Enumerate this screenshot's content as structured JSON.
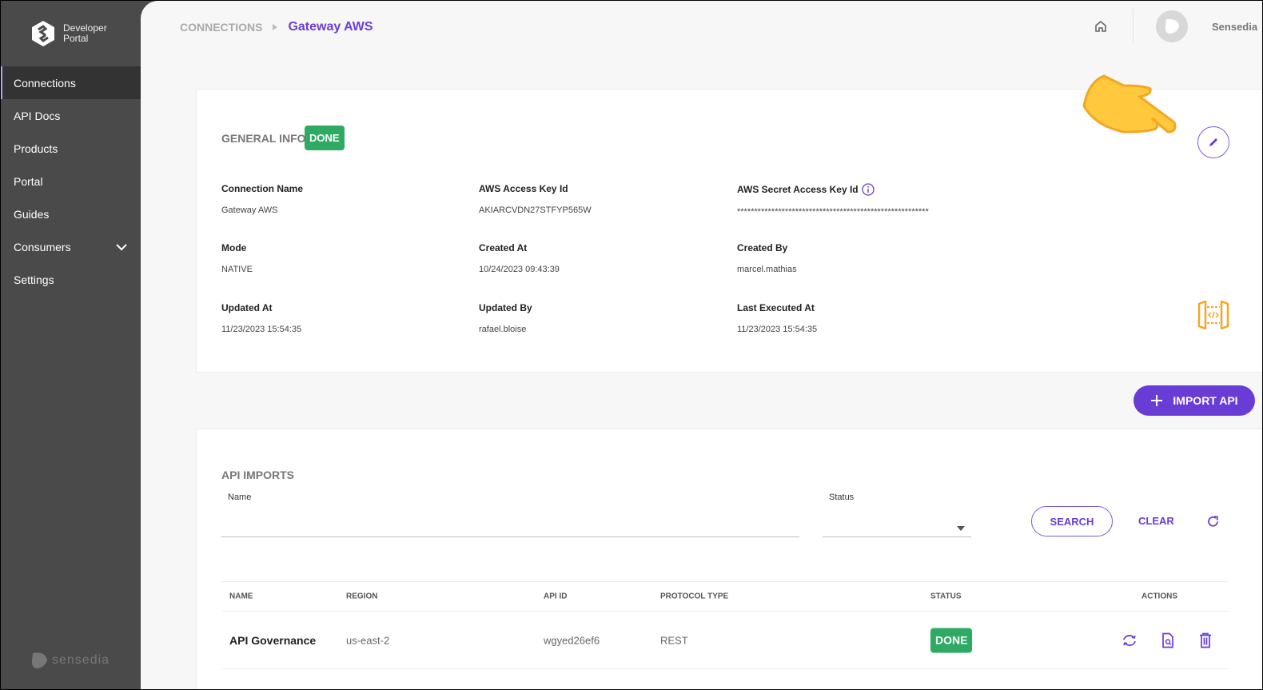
{
  "sidebar": {
    "logo_text_1": "Developer",
    "logo_text_2": "Portal",
    "items": [
      {
        "label": "Connections",
        "active": true
      },
      {
        "label": "API Docs"
      },
      {
        "label": "Products"
      },
      {
        "label": "Portal"
      },
      {
        "label": "Guides"
      },
      {
        "label": "Consumers",
        "expandable": true
      },
      {
        "label": "Settings"
      }
    ],
    "brand": "sensedia"
  },
  "header": {
    "breadcrumb_root": "CONNECTIONS",
    "breadcrumb_current": "Gateway AWS",
    "user_name": "Sensedia"
  },
  "general": {
    "title": "GENERAL INFO",
    "status": "DONE",
    "fields": [
      {
        "label": "Connection Name",
        "value": "Gateway AWS"
      },
      {
        "label": "AWS Access Key Id",
        "value": "AKIARCVDN27STFYP565W"
      },
      {
        "label": "AWS Secret Access Key Id",
        "value": "********************************************************"
      },
      {
        "label": "Mode",
        "value": "NATIVE"
      },
      {
        "label": "Created At",
        "value": "10/24/2023 09:43:39"
      },
      {
        "label": "Created By",
        "value": "marcel.mathias"
      },
      {
        "label": "Updated At",
        "value": "11/23/2023 15:54:35"
      },
      {
        "label": "Updated By",
        "value": "rafael.bloise"
      },
      {
        "label": "Last Executed At",
        "value": "11/23/2023 15:54:35"
      }
    ]
  },
  "import_button": "IMPORT API",
  "imports": {
    "title": "API IMPORTS",
    "name_label": "Name",
    "name_value": "",
    "status_label": "Status",
    "status_value": "",
    "search": "SEARCH",
    "clear": "CLEAR",
    "columns": [
      "NAME",
      "REGION",
      "API ID",
      "PROTOCOL TYPE",
      "STATUS",
      "ACTIONS"
    ],
    "rows": [
      {
        "name": "API Governance",
        "region": "us-east-2",
        "api_id": "wgyed26ef6",
        "protocol": "REST",
        "status": "DONE"
      }
    ]
  },
  "colors": {
    "accent": "#6a3cd6",
    "success": "#2eaa63",
    "sidebar": "#4a4a4a",
    "aws_icon": "#f5a623"
  }
}
